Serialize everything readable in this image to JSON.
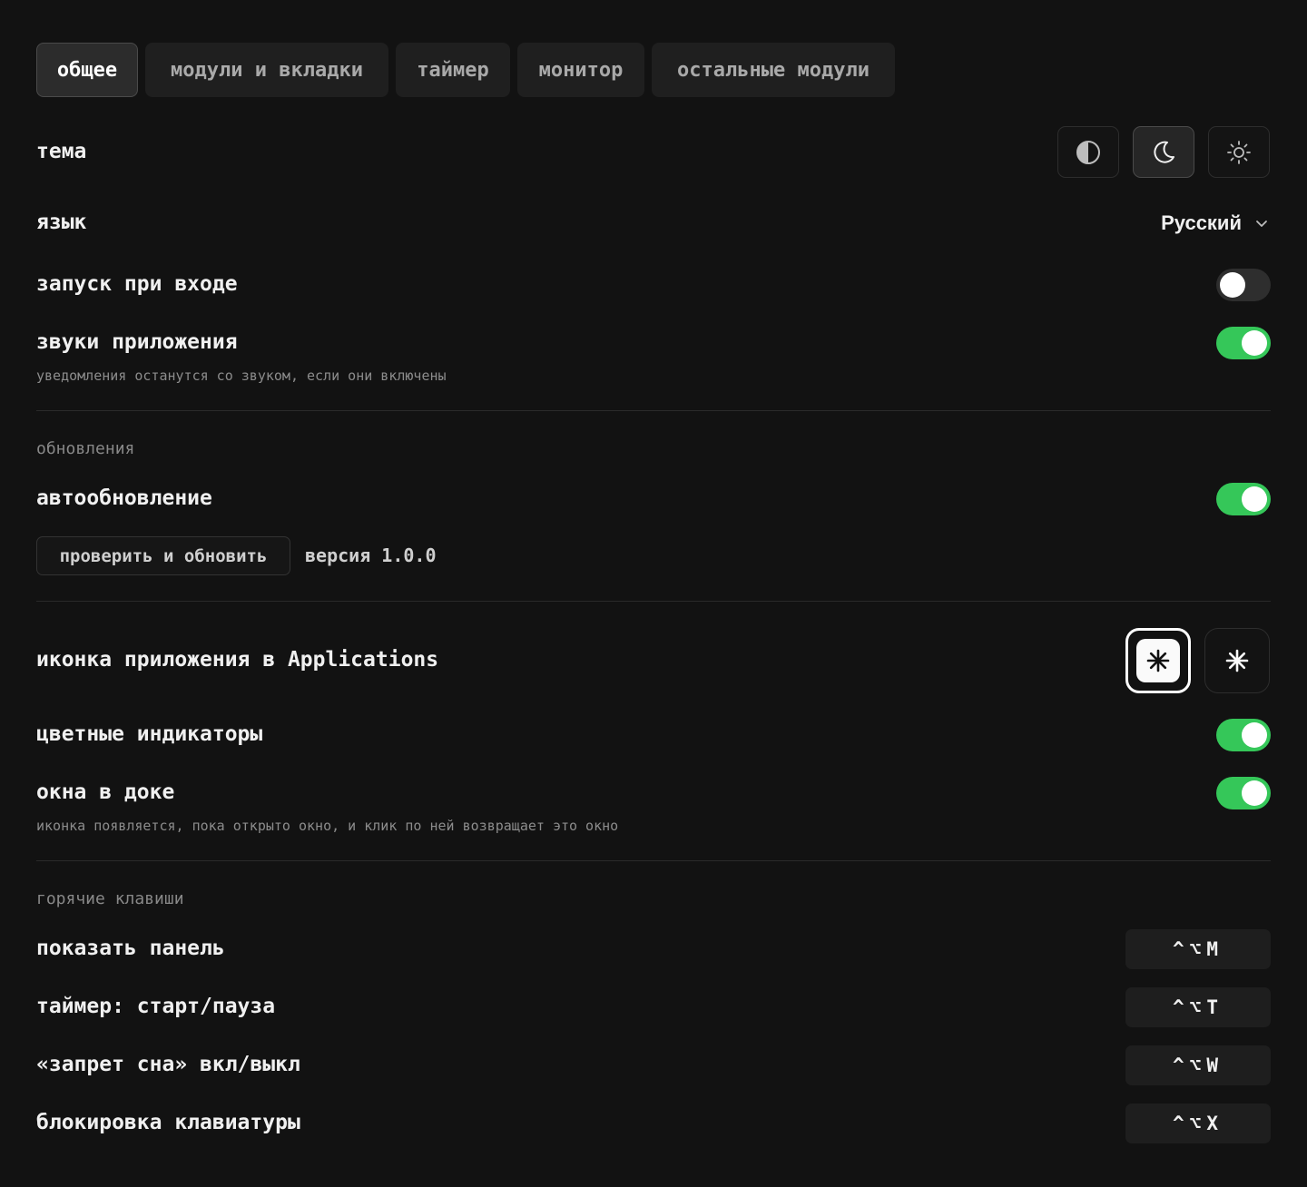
{
  "tabs": [
    {
      "label": "общее",
      "active": true
    },
    {
      "label": "модули и вкладки"
    },
    {
      "label": "таймер"
    },
    {
      "label": "монитор"
    },
    {
      "label": "остальные модули"
    }
  ],
  "general": {
    "theme_label": "тема",
    "theme_options": [
      "auto-theme-icon",
      "moon-icon",
      "sun-icon"
    ],
    "theme_selected": "moon-icon",
    "language_label": "язык",
    "language_value": "Русский",
    "launch_label": "запуск при входе",
    "launch_on": false,
    "sounds_label": "звуки приложения",
    "sounds_on": true,
    "sounds_desc": "уведомления останутся со звуком, если они включены"
  },
  "updates": {
    "section_title": "обновления",
    "auto_label": "автообновление",
    "auto_on": true,
    "check_button": "проверить и обновить",
    "version_text": "версия 1.0.0"
  },
  "appearance": {
    "app_icon_label": "иконка приложения в Applications",
    "app_icon_options": [
      "light-asterisk-icon",
      "dark-asterisk-icon"
    ],
    "app_icon_selected": "light-asterisk-icon",
    "color_indicators_label": "цветные индикаторы",
    "color_indicators_on": true,
    "dock_windows_label": "окна в доке",
    "dock_windows_on": true,
    "dock_windows_desc": "иконка появляется, пока открыто окно, и клик по ней возвращает это окно"
  },
  "hotkeys": {
    "section_title": "горячие клавиши",
    "items": [
      {
        "label": "показать панель",
        "keys": "^⌥M"
      },
      {
        "label": "таймер: старт/пауза",
        "keys": "^⌥T"
      },
      {
        "label": "«запрет сна» вкл/выкл",
        "keys": "^⌥W"
      },
      {
        "label": "блокировка клавиатуры",
        "keys": "^⌥X"
      }
    ]
  },
  "colors": {
    "background": "#121212",
    "toggle_on": "#35c759",
    "toggle_off": "#2e2e2e"
  }
}
